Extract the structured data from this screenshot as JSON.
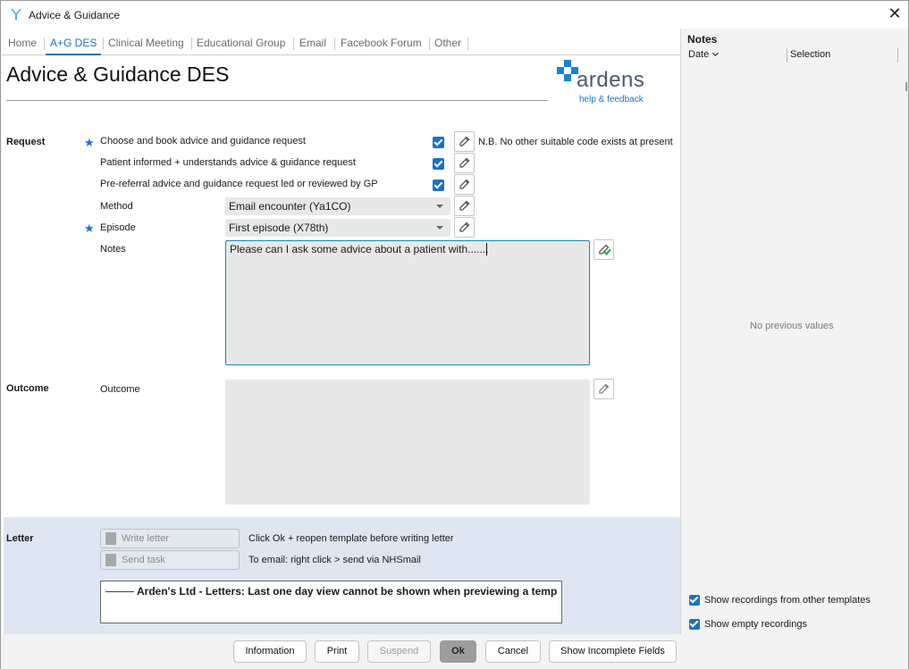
{
  "window": {
    "title": "Advice & Guidance",
    "close_glyph": "✕"
  },
  "tabs": [
    {
      "label": "Home",
      "active": false
    },
    {
      "label": "A+G DES",
      "active": true
    },
    {
      "label": "Clinical Meeting",
      "active": false
    },
    {
      "label": "Educational Group",
      "active": false
    },
    {
      "label": "Email",
      "active": false
    },
    {
      "label": "Facebook Forum",
      "active": false
    },
    {
      "label": "Other",
      "active": false
    }
  ],
  "page": {
    "title": "Advice & Guidance DES"
  },
  "logo": {
    "brand": "ardens",
    "help_link": "help & feedback"
  },
  "request": {
    "section_label": "Request",
    "choose_book_label": "Choose and book advice and guidance request",
    "choose_book_checked": true,
    "nb_text": "N.B. No other suitable code exists at present",
    "patient_informed_label": "Patient informed + understands advice & guidance request",
    "patient_informed_checked": true,
    "pre_referral_label": "Pre-referral advice and guidance request led or reviewed by GP",
    "pre_referral_checked": true,
    "method_label": "Method",
    "method_value": "Email encounter (Ya1CO)",
    "episode_label": "Episode",
    "episode_value": "First episode (X78th)",
    "notes_label": "Notes",
    "notes_value": "Please can I ask some advice about a patient with.......",
    "star_glyph": "★"
  },
  "outcome": {
    "section_label": "Outcome",
    "field_label": "Outcome",
    "value": ""
  },
  "letter": {
    "section_label": "Letter",
    "write_letter_label": "Write letter",
    "write_letter_note": "Click Ok + reopen template before writing letter",
    "send_task_label": "Send task",
    "send_task_note": "To email: right click > send via NHSmail",
    "preview_text": "Arden's Ltd - Letters: Last one day view cannot be shown when previewing a temp"
  },
  "notes_panel": {
    "title": "Notes",
    "col_date": "Date",
    "col_selection": "Selection",
    "empty_text": "No previous values",
    "show_other_templates_label": "Show recordings from other templates",
    "show_other_templates_checked": true,
    "show_empty_label": "Show empty recordings",
    "show_empty_checked": true
  },
  "footer": {
    "information": "Information",
    "print": "Print",
    "suspend": "Suspend",
    "ok": "Ok",
    "cancel": "Cancel",
    "show_incomplete": "Show Incomplete Fields"
  },
  "colors": {
    "accent": "#1b72c0",
    "logo_cross": "#1a86c9",
    "letter_panel": "#dde6f1"
  }
}
